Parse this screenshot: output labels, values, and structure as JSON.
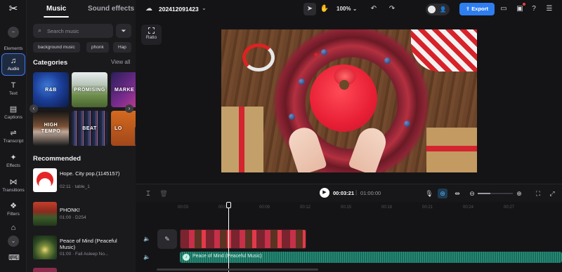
{
  "colors": {
    "accent": "#3c7cf5",
    "export": "#2e7ef0",
    "audio_clip": "#1c6b5b",
    "background": "#141416"
  },
  "rail": {
    "logo": "capcut-logo",
    "items": [
      {
        "label": "Elements",
        "icon": "elements-icon"
      },
      {
        "label": "Audio",
        "icon": "audio-icon",
        "active": true
      },
      {
        "label": "Text",
        "icon": "text-icon"
      },
      {
        "label": "Captions",
        "icon": "captions-icon"
      },
      {
        "label": "Transcript",
        "icon": "transcript-icon"
      },
      {
        "label": "Effects",
        "icon": "effects-icon"
      },
      {
        "label": "Transitions",
        "icon": "transitions-icon"
      },
      {
        "label": "Filters",
        "icon": "filters-icon"
      }
    ]
  },
  "panel": {
    "tabs": {
      "music": "Music",
      "sound_effects": "Sound effects"
    },
    "search": {
      "placeholder": "Search music"
    },
    "chips": [
      "background music",
      "phonk",
      "Hap"
    ],
    "categories_title": "Categories",
    "view_all": "View all",
    "categories": [
      "R&B",
      "PROMISING",
      "MARKE",
      "HIGH\nTEMPO",
      "BEAT",
      "LO"
    ],
    "recommended_title": "Recommended",
    "tracks": [
      {
        "title": "Hope. City pop.(1145157)",
        "meta": "02:11 · table_1"
      },
      {
        "title": "PHONK!",
        "meta": "01:00 · D254"
      },
      {
        "title": "Peace of Mind (Peaceful Music)",
        "meta": "01:00 · Fall Asleep No..."
      }
    ]
  },
  "topbar": {
    "project_name": "202412091423",
    "zoom": "100%",
    "export_label": "Export"
  },
  "stage": {
    "ratio_label": "Ratio"
  },
  "timeline": {
    "current_time": "00:03:21",
    "separator": "|",
    "total_time": "01:00:00",
    "zoom_level": 0.35,
    "ruler_marks": [
      "00:03",
      "00:06",
      "00:09",
      "00:12",
      "00:15",
      "00:18",
      "00:21",
      "00:24",
      "00:27"
    ],
    "audio_clip_label": "Peace of Mind (Peaceful Music)"
  }
}
